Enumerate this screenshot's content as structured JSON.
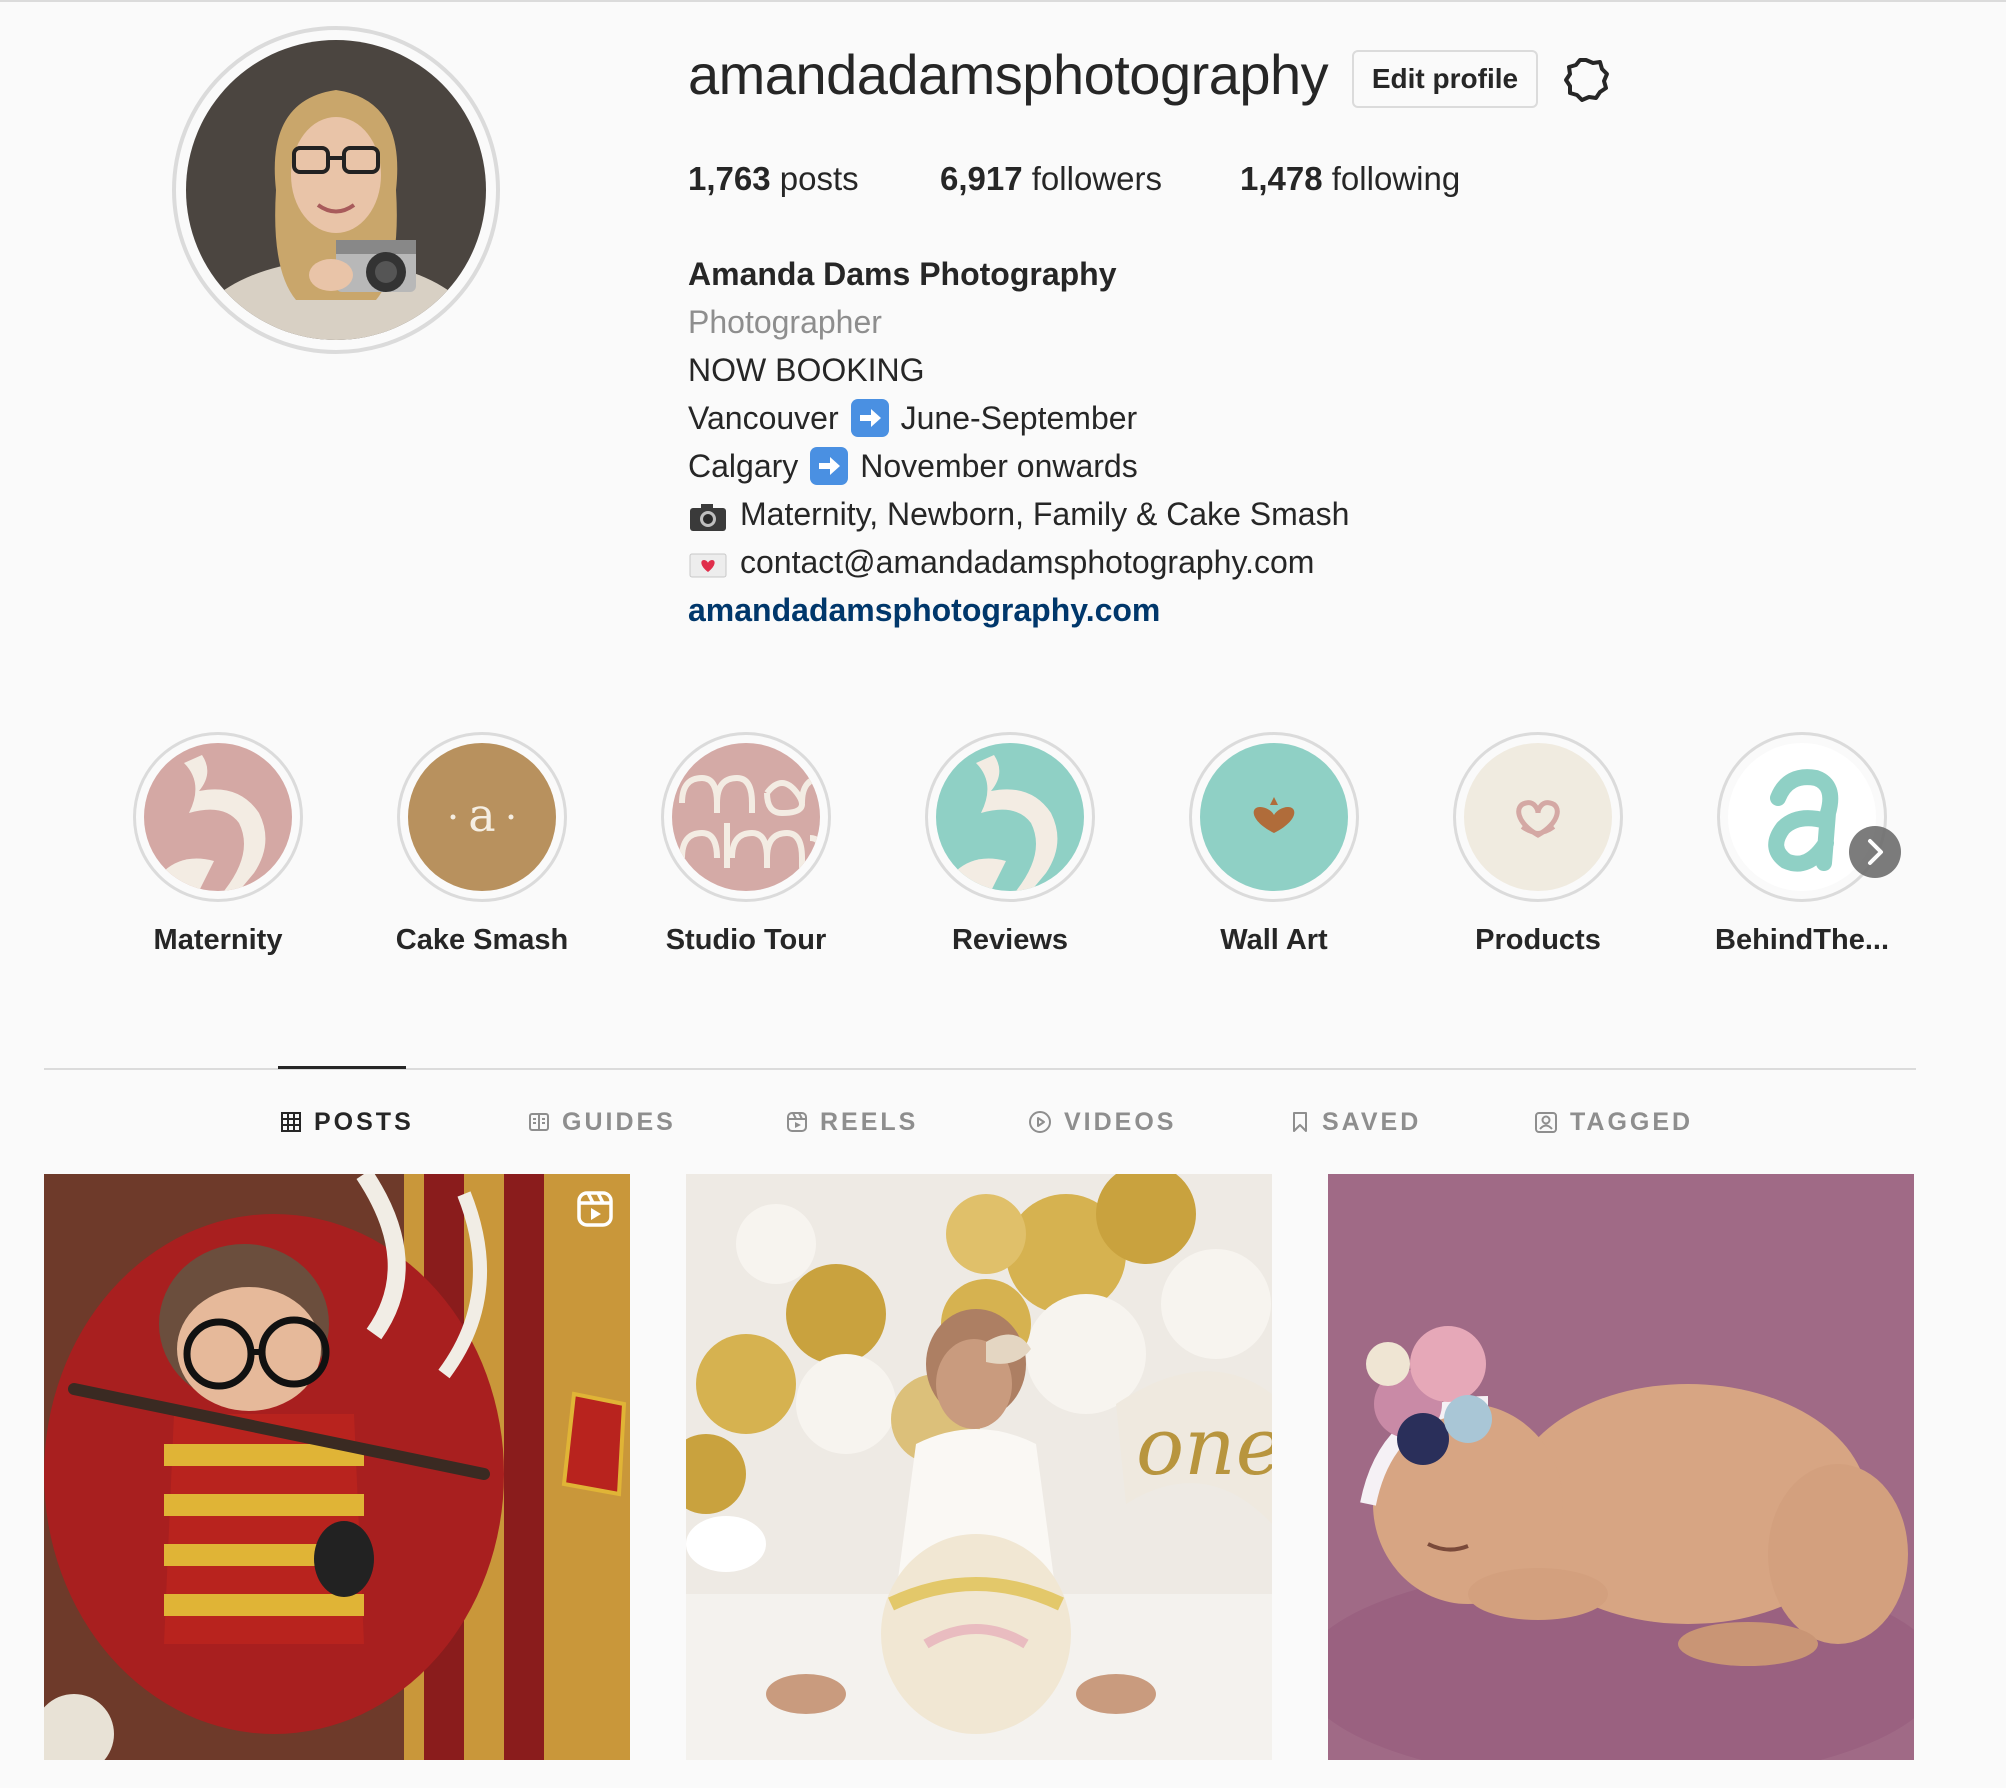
{
  "profile": {
    "username": "amandadamsphotography",
    "edit_profile_label": "Edit profile",
    "settings_icon": "gear-icon",
    "avatar_alt": "Profile photo"
  },
  "stats": {
    "posts_count": "1,763",
    "posts_label": "posts",
    "followers_count": "6,917",
    "followers_label": "followers",
    "following_count": "1,478",
    "following_label": "following"
  },
  "bio": {
    "name": "Amanda Dams Photography",
    "category": "Photographer",
    "line1": "NOW BOOKING",
    "line2_city": "Vancouver",
    "line2_dates": "June-September",
    "line3_city": "Calgary",
    "line3_dates": "November onwards",
    "line4": "Maternity, Newborn, Family & Cake Smash",
    "line5": "contact@amandadamsphotography.com",
    "website": "amandadamsphotography.com"
  },
  "highlights": [
    {
      "label": "Maternity",
      "color": "#d4a8a4"
    },
    {
      "label": "Cake Smash",
      "color": "#b8915e"
    },
    {
      "label": "Studio Tour",
      "color": "#d4aaa6"
    },
    {
      "label": "Reviews",
      "color": "#8fd0c5"
    },
    {
      "label": "Wall Art",
      "color": "#8fd0c5"
    },
    {
      "label": "Products",
      "color": "#f0ebe0"
    },
    {
      "label": "BehindThe...",
      "color": "#ffffff"
    }
  ],
  "tabs": [
    {
      "label": "POSTS",
      "icon": "grid-icon",
      "active": true
    },
    {
      "label": "GUIDES",
      "icon": "guide-icon",
      "active": false
    },
    {
      "label": "REELS",
      "icon": "reels-icon",
      "active": false
    },
    {
      "label": "VIDEOS",
      "icon": "play-icon",
      "active": false
    },
    {
      "label": "SAVED",
      "icon": "bookmark-icon",
      "active": false
    },
    {
      "label": "TAGGED",
      "icon": "tag-icon",
      "active": false
    }
  ],
  "colors": {
    "text": "#262626",
    "muted": "#8e8e8e",
    "link": "#00376b",
    "border": "#dbdbdb",
    "background": "#fafafa"
  }
}
